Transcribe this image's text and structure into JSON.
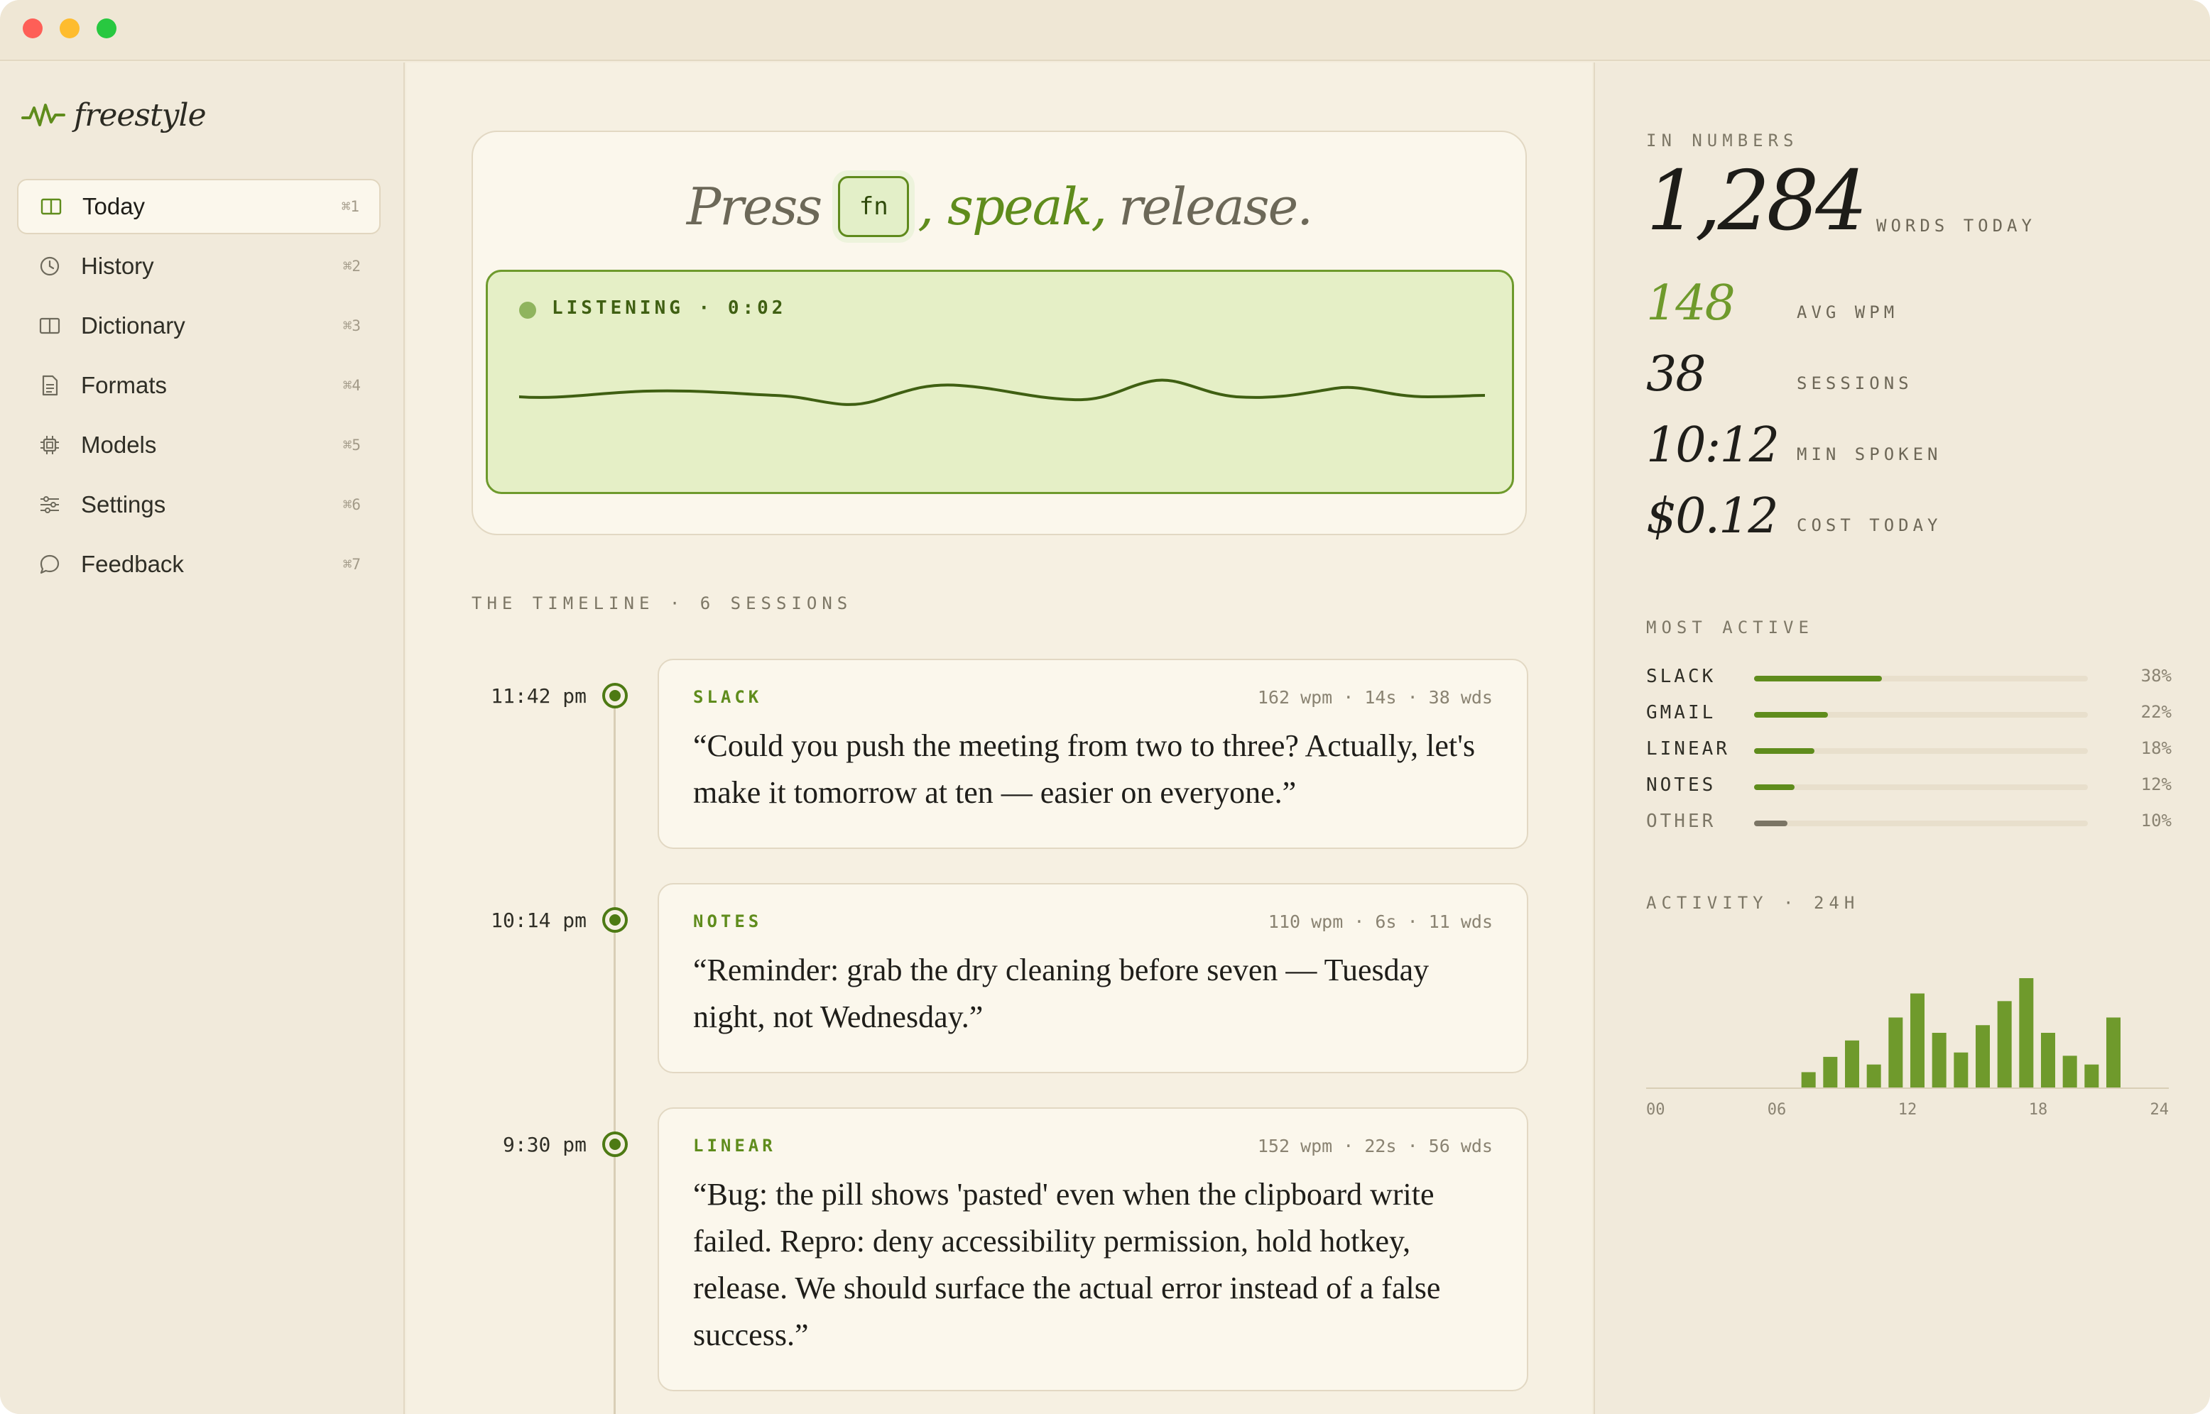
{
  "app": {
    "name": "freestyle"
  },
  "sidebar": {
    "items": [
      {
        "label": "Today",
        "shortcut": "⌘1",
        "icon": "book-open-icon",
        "active": true
      },
      {
        "label": "History",
        "shortcut": "⌘2",
        "icon": "clock-icon"
      },
      {
        "label": "Dictionary",
        "shortcut": "⌘3",
        "icon": "book-icon"
      },
      {
        "label": "Formats",
        "shortcut": "⌘4",
        "icon": "document-icon"
      },
      {
        "label": "Models",
        "shortcut": "⌘5",
        "icon": "chip-icon"
      },
      {
        "label": "Settings",
        "shortcut": "⌘6",
        "icon": "sliders-icon"
      },
      {
        "label": "Feedback",
        "shortcut": "⌘7",
        "icon": "chat-bubble-icon"
      }
    ]
  },
  "hero": {
    "press": "Press",
    "key": "fn",
    "speak": ", speak,",
    "release": "release.",
    "status": "LISTENING · 0:02"
  },
  "timeline": {
    "title": "THE TIMELINE · 6 SESSIONS",
    "sessions": [
      {
        "time": "11:42 pm",
        "app": "SLACK",
        "meta": "162 wpm · 14s · 38 wds",
        "text": "“Could you push the meeting from two to three? Actually, let's make it tomorrow at ten — easier on everyone.”"
      },
      {
        "time": "10:14 pm",
        "app": "NOTES",
        "meta": "110 wpm · 6s · 11 wds",
        "text": "“Reminder: grab the dry cleaning before seven — Tuesday night, not Wednesday.”"
      },
      {
        "time": "9:30 pm",
        "app": "LINEAR",
        "meta": "152 wpm · 22s · 56 wds",
        "text": "“Bug: the pill shows 'pasted' even when the clipboard write failed. Repro: deny accessibility permission, hold hotkey, release. We should surface the actual error instead of a false success.”"
      }
    ]
  },
  "stats": {
    "title": "IN NUMBERS",
    "words": "1,284",
    "words_label": "WORDS TODAY",
    "rows": [
      {
        "value": "148",
        "label": "AVG WPM"
      },
      {
        "value": "38",
        "label": "SESSIONS"
      },
      {
        "value": "10:12",
        "label": "MIN SPOKEN"
      },
      {
        "value": "$0.12",
        "label": "COST TODAY"
      }
    ]
  },
  "most_active": {
    "title": "MOST ACTIVE",
    "apps": [
      {
        "name": "SLACK",
        "pct": "38%",
        "value": 38
      },
      {
        "name": "GMAIL",
        "pct": "22%",
        "value": 22
      },
      {
        "name": "LINEAR",
        "pct": "18%",
        "value": 18
      },
      {
        "name": "NOTES",
        "pct": "12%",
        "value": 12
      },
      {
        "name": "OTHER",
        "pct": "10%",
        "value": 10
      }
    ]
  },
  "activity": {
    "title": "ACTIVITY · 24H",
    "ticks": [
      "00",
      "06",
      "12",
      "18",
      "24"
    ]
  },
  "chart_data": {
    "type": "bar",
    "title": "ACTIVITY · 24H",
    "x": [
      7,
      8,
      9,
      10,
      11,
      12,
      13,
      14,
      15,
      16,
      17,
      18,
      19,
      20,
      21
    ],
    "values": [
      0.14,
      0.28,
      0.43,
      0.21,
      0.64,
      0.86,
      0.5,
      0.32,
      0.57,
      0.79,
      1.0,
      0.5,
      0.29,
      0.21,
      0.64
    ],
    "xlim": [
      0,
      24
    ],
    "xticks": [
      "00",
      "06",
      "12",
      "18",
      "24"
    ],
    "color": "#6f9a2c"
  },
  "colors": {
    "accent": "#5f8c1c",
    "background": "#f6f0e2",
    "card": "#fbf7ec",
    "listening": "#e5efc6"
  }
}
